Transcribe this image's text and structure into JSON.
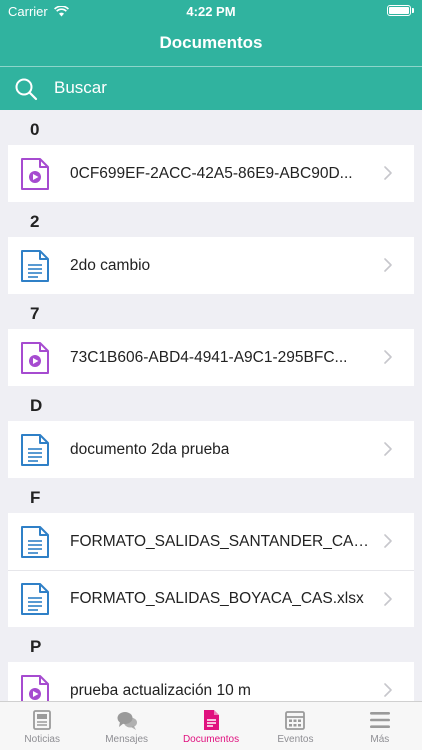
{
  "status_bar": {
    "carrier": "Carrier",
    "time": "4:22 PM"
  },
  "nav": {
    "title": "Documentos"
  },
  "search": {
    "placeholder": "Buscar"
  },
  "sections": [
    {
      "header": "0",
      "items": [
        {
          "label": "0CF699EF-2ACC-42A5-86E9-ABC90D...",
          "icon": "video-file-icon"
        }
      ]
    },
    {
      "header": "2",
      "items": [
        {
          "label": "2do cambio",
          "icon": "document-file-icon"
        }
      ]
    },
    {
      "header": "7",
      "items": [
        {
          "label": "73C1B606-ABD4-4941-A9C1-295BFC...",
          "icon": "video-file-icon"
        }
      ]
    },
    {
      "header": "D",
      "items": [
        {
          "label": "documento 2da prueba",
          "icon": "document-file-icon"
        }
      ]
    },
    {
      "header": "F",
      "items": [
        {
          "label": "FORMATO_SALIDAS_SANTANDER_CAS....",
          "icon": "document-file-icon"
        },
        {
          "label": "FORMATO_SALIDAS_BOYACA_CAS.xlsx",
          "icon": "document-file-icon"
        }
      ]
    },
    {
      "header": "P",
      "items": [
        {
          "label": "prueba actualización 10 m",
          "icon": "video-file-icon"
        }
      ]
    }
  ],
  "tabs": [
    {
      "label": "Noticias",
      "icon": "news-icon",
      "active": false
    },
    {
      "label": "Mensajes",
      "icon": "chat-bubbles-icon",
      "active": false
    },
    {
      "label": "Documentos",
      "icon": "document-icon",
      "active": true
    },
    {
      "label": "Eventos",
      "icon": "calendar-icon",
      "active": false
    },
    {
      "label": "Más",
      "icon": "menu-icon",
      "active": false
    }
  ],
  "colors": {
    "header_bg": "#30b39f",
    "video_icon": "#a64bd0",
    "document_icon": "#2f80c7",
    "tab_active": "#e0117f",
    "tab_inactive": "#9a9a9a"
  }
}
